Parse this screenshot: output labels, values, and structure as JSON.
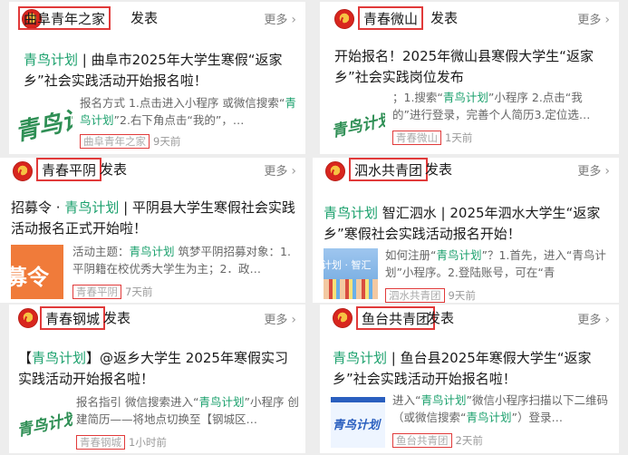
{
  "cards": [
    {
      "account": "曲阜青年之家",
      "publish_label": "发表",
      "more_label": "更多",
      "title_kw": "青鸟计划",
      "title_rest": " | 曲阜市2025年大学生寒假“返家乡”社会实践活动开始报名啦！",
      "snippet_pre": "报名方式 1.点击进入小程序 或微信搜索“",
      "snippet_kw": "青鸟计划",
      "snippet_post": "”2.右下角点击“我的”，…",
      "source": "曲阜青年之家",
      "time": "9天前",
      "thumb_text": "青鸟计"
    },
    {
      "account": "青春微山",
      "publish_label": "发表",
      "more_label": "更多",
      "title_pre": "开始报名！2025年微山县寒假大学生“返家乡”社会实践岗位发布",
      "snippet_pre": "；1.搜索“",
      "snippet_kw": "青鸟计划",
      "snippet_post": "”小程序 2.点击“我的”进行登录，完善个人简历3.定位选…",
      "source": "青春微山",
      "time": "1天前",
      "thumb_text": "青鸟计划"
    },
    {
      "account": "青春平阴",
      "publish_label": "发表",
      "more_label": "更多",
      "title_pre": "招募令 · ",
      "title_kw": "青鸟计划",
      "title_rest": " | 平阴县大学生寒假社会实践活动报名正式开始啦！",
      "snippet_pre": "活动主题：",
      "snippet_kw": "青鸟计划",
      "snippet_post": " 筑梦平阴招募对象：1. 平阴籍在校优秀大学生为主；2．政…",
      "source": "青春平阴",
      "time": "7天前",
      "thumb_text": "募令"
    },
    {
      "account": "泗水共青团",
      "publish_label": "发表",
      "more_label": "更多",
      "title_kw": "青鸟计划",
      "title_rest": " 智汇泗水 | 2025年泗水大学生“返家乡”寒假社会实践活动报名开始！",
      "snippet_pre": "如何注册“",
      "snippet_kw": "青鸟计划",
      "snippet_post": "”？1.首先，进入“青鸟计划”小程序。2.登陆账号，可在“青",
      "source": "泗水共青团",
      "time": "9天前",
      "thumb_text": "计划 · 智汇"
    },
    {
      "account": "青春钢城",
      "publish_label": "发表",
      "more_label": "更多",
      "title_pre": "【",
      "title_kw": "青鸟计划",
      "title_rest": "】@返乡大学生 2025年寒假实习实践活动开始报名啦！",
      "snippet_pre": "报名指引 微信搜索进入“",
      "snippet_kw": "青鸟计划",
      "snippet_post": "”小程序 创建简历——将地点切换至【钢城区…",
      "source": "青春钢城",
      "time": "1小时前",
      "thumb_text": "青鸟计划"
    },
    {
      "account": "鱼台共青团",
      "publish_label": "发表",
      "more_label": "更多",
      "title_kw": "青鸟计划",
      "title_rest": " | 鱼台县2025年寒假大学生“返家乡”社会实践活动开始报名啦！",
      "snippet_pre": "进入“",
      "snippet_kw": "青鸟计划",
      "snippet_mid": "”微信小程序扫描以下二维码（或微信搜索“",
      "snippet_kw2": "青鸟计划",
      "snippet_post": "”）登录…",
      "source": "鱼台共青团",
      "time": "2天前",
      "thumb_text": "青鸟计划"
    }
  ],
  "colors": {
    "keyword": "#1aa06c",
    "highlight_box": "#e13a3a",
    "background": "#ededed"
  },
  "icons": {
    "badge": "youth-league-badge-icon",
    "more": "chevron-right-icon"
  }
}
